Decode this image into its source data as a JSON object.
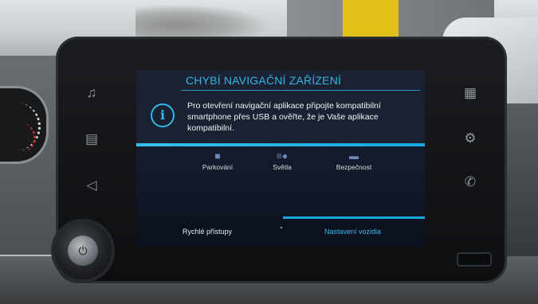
{
  "dialog": {
    "title": "CHYBÍ NAVIGAČNÍ ZAŘÍZENÍ",
    "message": "Pro otevření navigační aplikace připojte kompatibilní smartphone přes USB a ověřte, že je Vaše aplikace kompatibilní.",
    "icon": "info-icon"
  },
  "tiles": [
    {
      "label": "Parkování",
      "icon": "parking-icon"
    },
    {
      "label": "Světla",
      "icon": "lights-icon"
    },
    {
      "label": "Bezpečnost",
      "icon": "safety-icon"
    }
  ],
  "tabs": {
    "quick_access": "Rychlé přístupy",
    "vehicle_settings": "Nastavení vozidla"
  },
  "bezel_left": [
    "music-icon",
    "car-icon",
    "navigation-icon"
  ],
  "bezel_right": [
    "apps-grid-icon",
    "settings-gear-icon",
    "phone-icon"
  ],
  "colors": {
    "accent": "#31b7ea",
    "screen_bg": "#1a2131",
    "text": "#f0f3f6"
  }
}
